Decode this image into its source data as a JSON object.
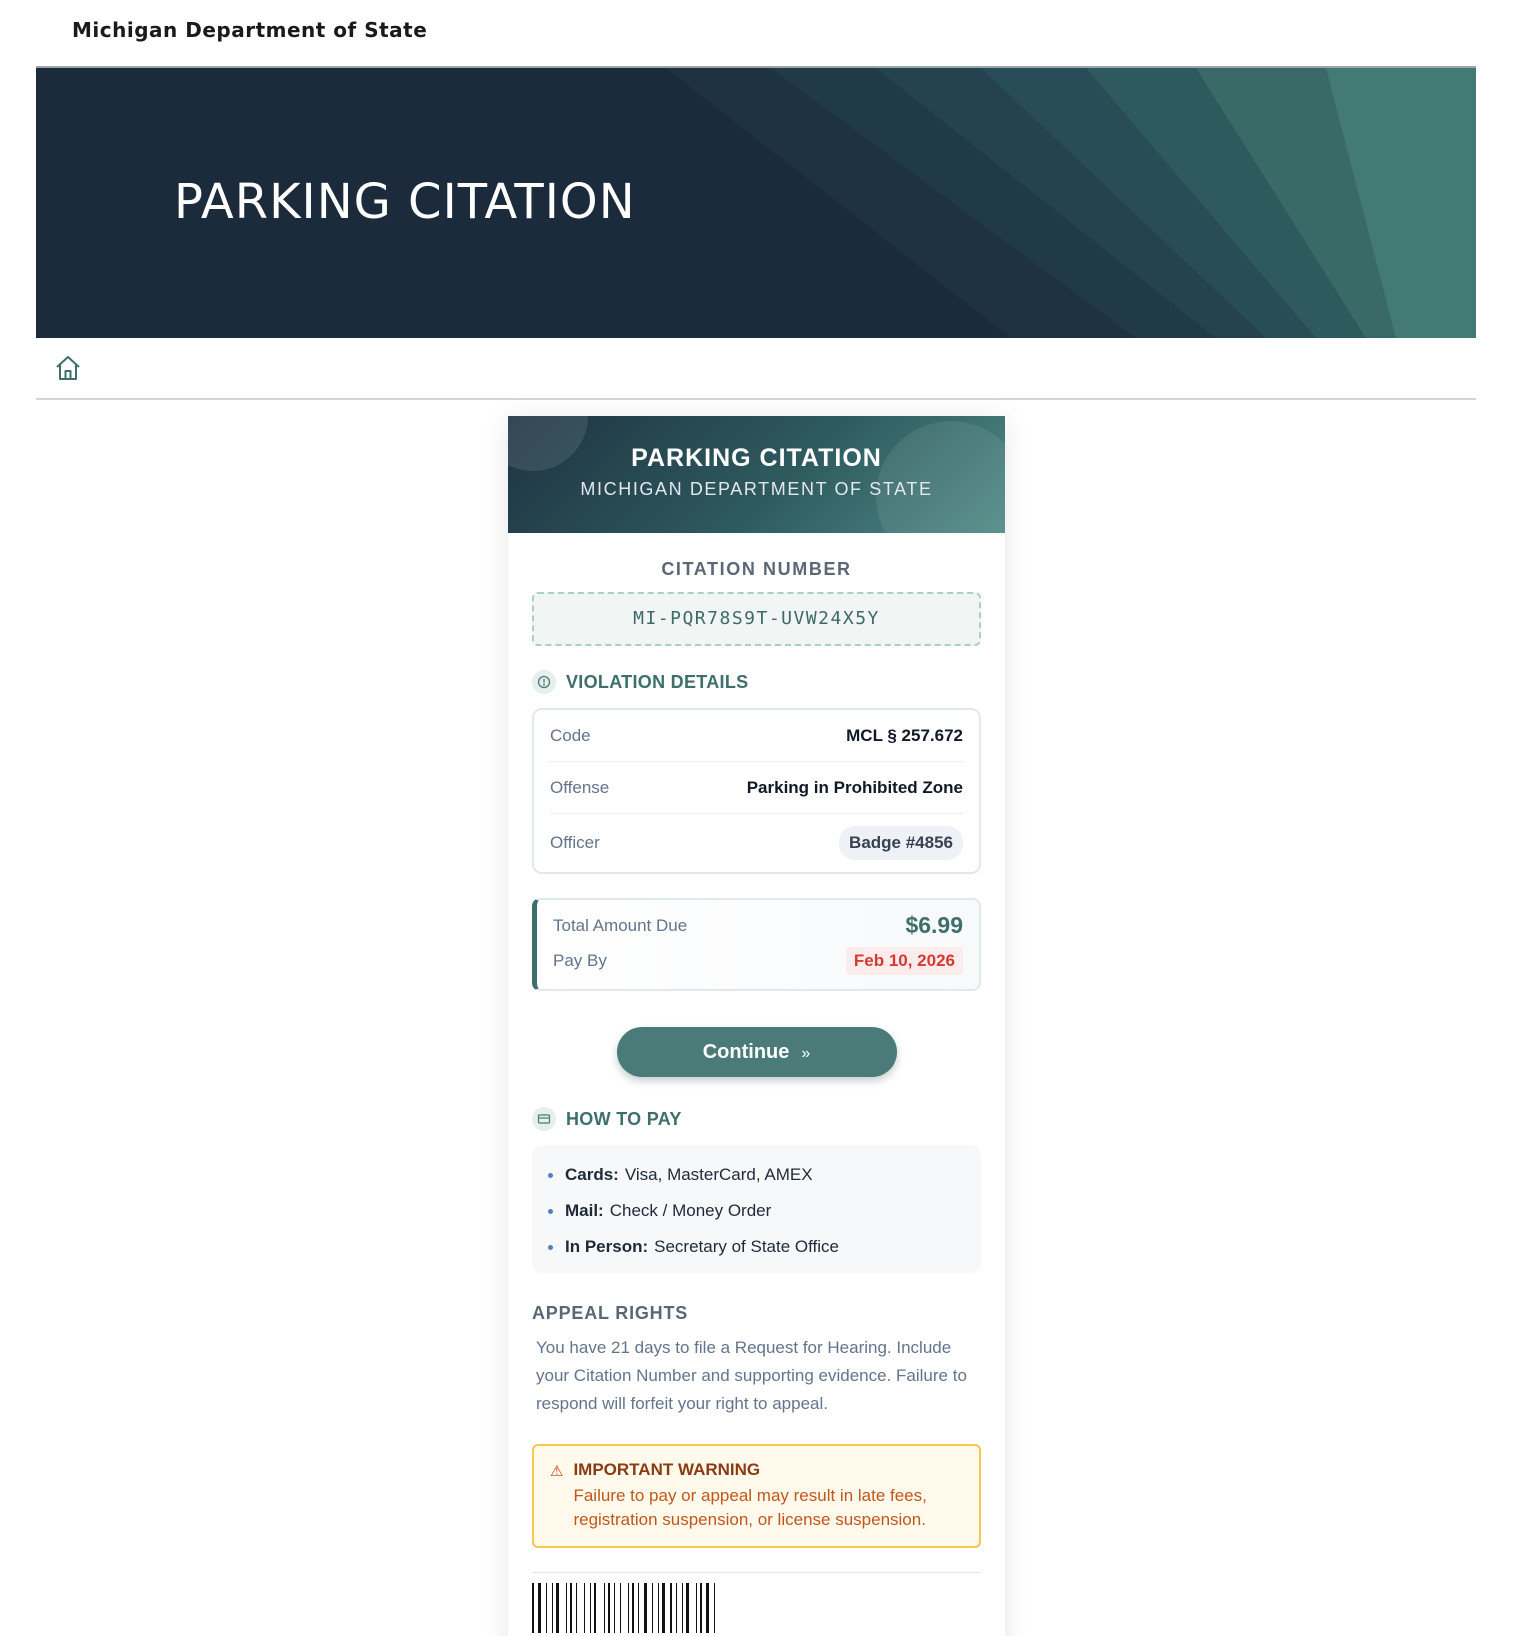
{
  "site": {
    "brand": "Michigan Department of State"
  },
  "hero": {
    "title": "PARKING CITATION"
  },
  "card": {
    "header_title": "PARKING CITATION",
    "header_subtitle": "MICHIGAN DEPARTMENT OF STATE",
    "citation_label": "CITATION NUMBER",
    "citation_number": "MI-PQR78S9T-UVW24X5Y",
    "violation": {
      "heading": "VIOLATION DETAILS",
      "rows": [
        {
          "key": "Code",
          "value": "MCL § 257.672"
        },
        {
          "key": "Offense",
          "value": "Parking in Prohibited Zone"
        },
        {
          "key": "Officer",
          "value": "Badge #4856"
        }
      ]
    },
    "amount": {
      "total_label": "Total Amount Due",
      "total_value": "$6.99",
      "pay_by_label": "Pay By",
      "pay_by_value": "Feb 10, 2026"
    },
    "continue_label": "Continue",
    "continue_icon": "»",
    "how_to_pay": {
      "heading": "HOW TO PAY",
      "items": [
        {
          "label": "Cards:",
          "value": "Visa, MasterCard, AMEX"
        },
        {
          "label": "Mail:",
          "value": "Check / Money Order"
        },
        {
          "label": "In Person:",
          "value": "Secretary of State Office"
        }
      ]
    },
    "appeal": {
      "heading": "APPEAL RIGHTS",
      "text": "You have 21 days to file a Request for Hearing. Include your Citation Number and supporting evidence. Failure to respond will forfeit your right to appeal."
    },
    "warning": {
      "icon": "⚠",
      "title": "IMPORTANT WARNING",
      "text": "Failure to pay or appeal may result in late fees, registration suspension, or license suspension."
    }
  },
  "colors": {
    "hero_bg": "#1c2b3b",
    "accent": "#3d6f6b",
    "button": "#4a7b78",
    "due_date": "#d43a32",
    "warning_border": "#f2c94c"
  },
  "icons": {
    "home": "home-icon",
    "violation": "clock-icon",
    "pay": "credit-card-icon",
    "warning": "warning-icon",
    "continue": "chevron-double-right-icon"
  }
}
